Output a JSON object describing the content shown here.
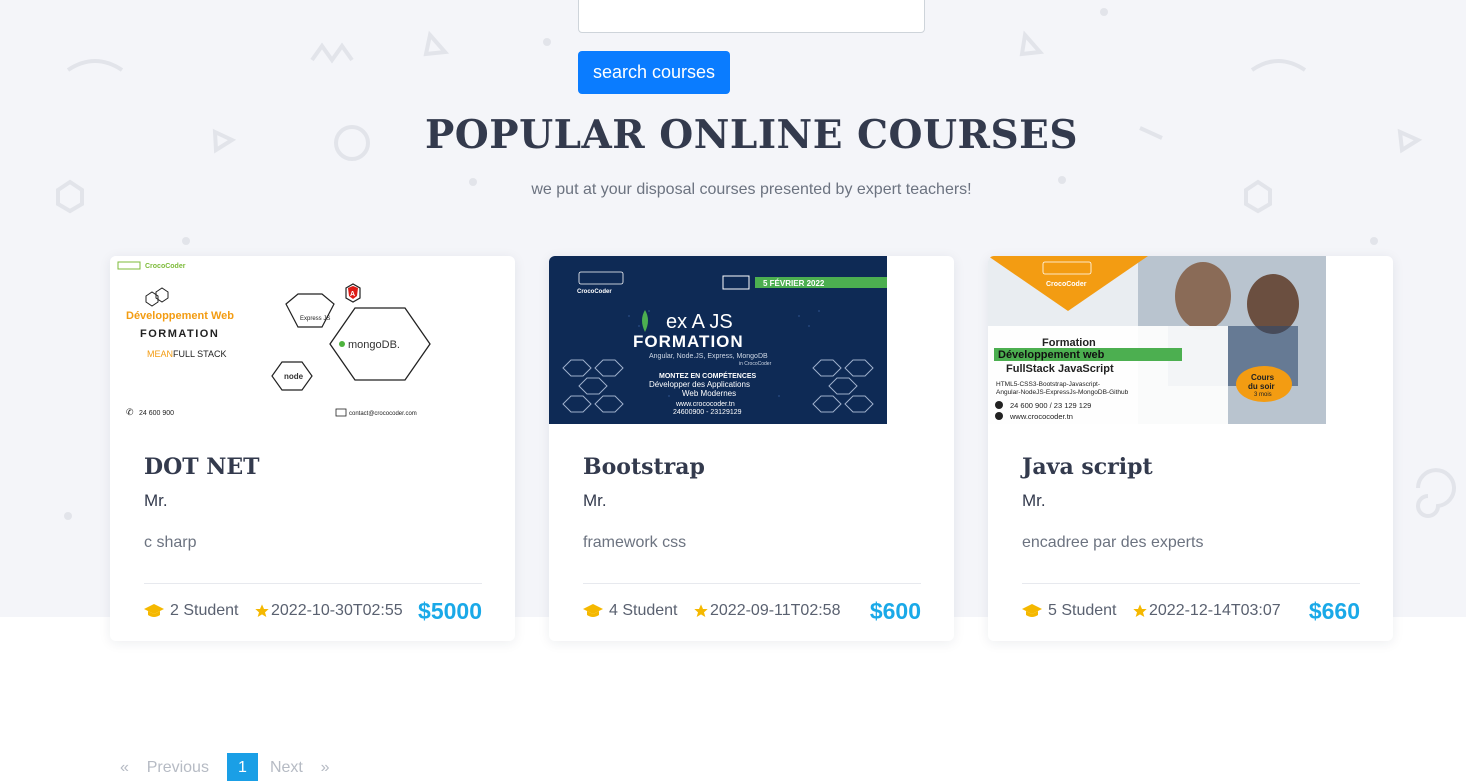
{
  "search": {
    "button_label": "search courses",
    "input_value": ""
  },
  "section": {
    "title": "POPULAR ONLINE COURSES",
    "subtitle": "we put at your disposal courses presented by expert teachers!"
  },
  "courses": [
    {
      "title": "DOT NET",
      "teacher": "Mr.",
      "description": "c sharp",
      "students": "2 Student",
      "date": "2022-10-30T02:55",
      "price": "$5000",
      "image": {
        "brand": "CrocoCoder",
        "line1": "Développement Web",
        "line2": "FORMATION",
        "line3_accent": "MEAN",
        "line3_rest": " FULL STACK",
        "phone": "24 600 900",
        "email": "contact@crococoder.com",
        "hex_express": "Express JS",
        "hex_angular": "A",
        "hex_mongo": "mongoDB.",
        "hex_node": "node"
      }
    },
    {
      "title": "Bootstrap",
      "teacher": "Mr.",
      "description": "framework css",
      "students": "4 Student",
      "date": "2022-09-11T02:58",
      "price": "$600",
      "image": {
        "brand": "CrocoCoder",
        "date_banner": "5 FÉVRIER 2022",
        "logos": "ex A JS",
        "heading": "FORMATION",
        "sub": "Angular, Node.JS, Express, MongoDB",
        "sub2": "in CrocoCoder",
        "skills1": "MONTEZ EN COMPÉTENCES",
        "skills2": "Développer des Applications",
        "skills3": "Web Modernes",
        "site": "www.crococoder.tn",
        "phones": "24600900 - 23129129"
      }
    },
    {
      "title": "Java script",
      "teacher": "Mr.",
      "description": "encadree par des experts",
      "students": "5 Student",
      "date": "2022-12-14T03:07",
      "price": "$660",
      "image": {
        "brand": "CrocoCoder",
        "line1": "Formation",
        "line2": "Développement web",
        "line3": "FullStack JavaScript",
        "stack1": "HTML5-CSS3-Bootstrap-Javascript-",
        "stack2": "Angular-NodeJS-ExpressJs-MongoDB-Github",
        "phones": "24 600 900 / 23 129 129",
        "site": "www.crococoder.tn",
        "badge1": "Cours",
        "badge2": "du soir",
        "badge3": "3 mois"
      }
    }
  ],
  "pagination": {
    "prev": "Previous",
    "current": "1",
    "next": "Next",
    "prev_arrow": "«",
    "next_arrow": "»"
  },
  "colors": {
    "accent": "#0a7cff",
    "price": "#1aa9e8",
    "title": "#333a4d",
    "star": "#f5b800"
  },
  "icons": {
    "students": "graduation-cap-icon",
    "date": "star-icon"
  }
}
